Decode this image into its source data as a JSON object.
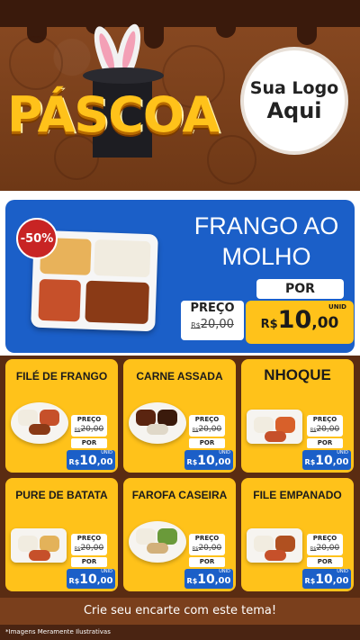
{
  "header": {
    "title": "PÁSCOA",
    "logo_line1": "Sua Logo",
    "logo_line2": "Aqui"
  },
  "featured": {
    "discount": "-50%",
    "title_line1": "FRANGO AO",
    "title_line2": "MOLHO",
    "por": "POR",
    "preco_label": "PREÇO",
    "old_currency": "R$",
    "old_price": "20,00",
    "unid": "UNID",
    "new_currency": "R$",
    "new_int": "10",
    "new_cents": ",00"
  },
  "products": [
    {
      "name": "FILÉ DE FRANGO"
    },
    {
      "name": "CARNE ASSADA"
    },
    {
      "name": "NHOQUE"
    },
    {
      "name": "PURE DE BATATA"
    },
    {
      "name": "FAROFA CASEIRA"
    },
    {
      "name": "FILE EMPANADO"
    }
  ],
  "price": {
    "preco_label": "PREÇO",
    "old_currency": "R$",
    "old_price": "20,00",
    "por": "POR",
    "unid": "UNID",
    "new_currency": "R$",
    "new_int": "10",
    "new_cents": ",00"
  },
  "footer": {
    "cta": "Crie seu encarte com este tema!",
    "disclaimer": "*Imagens Meramente Ilustrativas"
  },
  "colors": {
    "brown_dark": "#4a2412",
    "brown_header": "#7a3f1c",
    "yellow": "#ffc21a",
    "blue": "#1b5fc8",
    "red_badge": "#c82424"
  }
}
